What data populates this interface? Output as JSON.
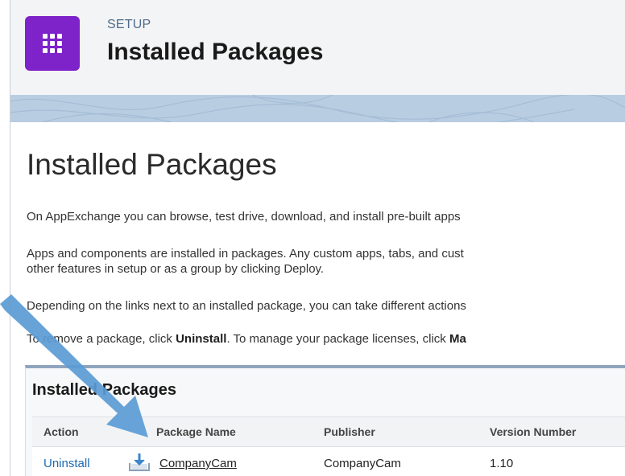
{
  "header": {
    "section": "SETUP",
    "title": "Installed Packages",
    "app_icon": "app-launcher-grid-icon"
  },
  "main": {
    "page_title": "Installed Packages",
    "paragraphs": {
      "p1": "On AppExchange you can browse, test drive, download, and install pre-built apps",
      "p2_line1": "Apps and components are installed in packages. Any custom apps, tabs, and cust",
      "p2_line2": "other features in setup or as a group by clicking Deploy.",
      "p3": "Depending on the links next to an installed package, you can take different actions",
      "p4_before": "To remove a package, click ",
      "p4_uninstall": "Uninstall",
      "p4_middle": ". To manage your package licenses, click ",
      "p4_end": "Ma"
    }
  },
  "installed_list": {
    "title": "Installed Packages",
    "columns": {
      "action": "Action",
      "package_name": "Package Name",
      "publisher": "Publisher",
      "version": "Version Number"
    },
    "rows": [
      {
        "action": "Uninstall",
        "icon": "package-download-icon",
        "package_name": "CompanyCam",
        "publisher": "CompanyCam",
        "version": "1.10"
      }
    ]
  },
  "annotation": {
    "arrow_color": "#5b9bd5"
  }
}
